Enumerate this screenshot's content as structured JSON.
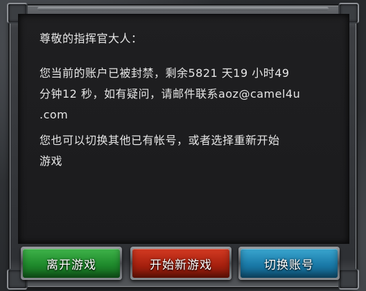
{
  "dialog": {
    "salutation": "尊敬的指挥官大人：",
    "ban_message_line1": "您当前的账户已被封禁，剩余5821 天19 小时49",
    "ban_message_line2": "分钟12 秒，如有疑问，请邮件联系aoz@camel4u",
    "ban_message_line3": ".com",
    "option_line1": "您也可以切换其他已有帐号，或者选择重新开始",
    "option_line2": "游戏"
  },
  "buttons": {
    "leave_game": "离开游戏",
    "start_new_game": "开始新游戏",
    "switch_account": "切换账号"
  },
  "colors": {
    "leave_button": "#1f8a2c",
    "new_game_button": "#a8210f",
    "switch_button": "#1a7aa8",
    "text": "#e6e6e6"
  }
}
